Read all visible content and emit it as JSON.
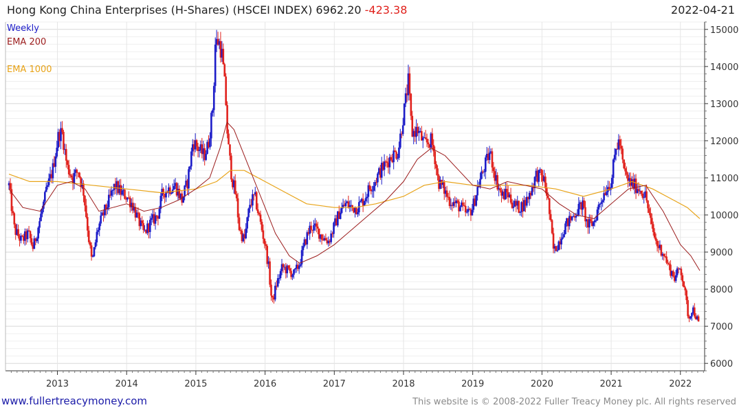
{
  "header": {
    "title": "Hong Kong China Enterprises (H-Shares) (HSCEI INDEX) 6962.20",
    "change": "-423.38",
    "date": "2022-04-21"
  },
  "footer": {
    "left": "www.fullertreacymoney.com",
    "right": "This website is © 2008-2022 Fuller Treacy Money plc. All rights reserved"
  },
  "colors": {
    "up": "#1c1cc8",
    "down": "#e0211c",
    "ema200": "#9b1b1b",
    "ema1000": "#e8a317",
    "grid": "#e2e2e2",
    "axis": "#333333"
  },
  "chart_data": {
    "type": "line",
    "subtype": "candlestick",
    "frequency_label": "Weekly",
    "ylim": [
      5800,
      15200
    ],
    "xlim": [
      2012.25,
      2022.35
    ],
    "yticks": [
      6000,
      7000,
      8000,
      9000,
      10000,
      11000,
      12000,
      13000,
      14000,
      15000
    ],
    "xticks": [
      {
        "label": "2013",
        "value": 2013
      },
      {
        "label": "2014",
        "value": 2014
      },
      {
        "label": "2015",
        "value": 2015
      },
      {
        "label": "2016",
        "value": 2016
      },
      {
        "label": "2017",
        "value": 2017
      },
      {
        "label": "2018",
        "value": 2018
      },
      {
        "label": "2019",
        "value": 2019
      },
      {
        "label": "2020",
        "value": 2020
      },
      {
        "label": "2021",
        "value": 2021
      },
      {
        "label": "2022",
        "value": 2022
      }
    ],
    "grid": true,
    "y_axis_position": "right",
    "legend_position": "top-left",
    "price_path": [
      [
        2012.3,
        10800
      ],
      [
        2012.38,
        9600
      ],
      [
        2012.48,
        9300
      ],
      [
        2012.58,
        9500
      ],
      [
        2012.65,
        9100
      ],
      [
        2012.75,
        9900
      ],
      [
        2012.85,
        10700
      ],
      [
        2012.93,
        11200
      ],
      [
        2013.02,
        12200
      ],
      [
        2013.07,
        12200
      ],
      [
        2013.14,
        11300
      ],
      [
        2013.22,
        11000
      ],
      [
        2013.3,
        11200
      ],
      [
        2013.38,
        10600
      ],
      [
        2013.45,
        9400
      ],
      [
        2013.5,
        8700
      ],
      [
        2013.58,
        9600
      ],
      [
        2013.66,
        10000
      ],
      [
        2013.75,
        10400
      ],
      [
        2013.83,
        10800
      ],
      [
        2013.92,
        10600
      ],
      [
        2014.0,
        10500
      ],
      [
        2014.08,
        10300
      ],
      [
        2014.16,
        9900
      ],
      [
        2014.25,
        9500
      ],
      [
        2014.35,
        9800
      ],
      [
        2014.45,
        10000
      ],
      [
        2014.52,
        10600
      ],
      [
        2014.6,
        10700
      ],
      [
        2014.7,
        10800
      ],
      [
        2014.8,
        10400
      ],
      [
        2014.88,
        10900
      ],
      [
        2014.96,
        12000
      ],
      [
        2015.03,
        11800
      ],
      [
        2015.12,
        11600
      ],
      [
        2015.18,
        11900
      ],
      [
        2015.25,
        13000
      ],
      [
        2015.28,
        14600
      ],
      [
        2015.33,
        14700
      ],
      [
        2015.38,
        14300
      ],
      [
        2015.43,
        13200
      ],
      [
        2015.46,
        12000
      ],
      [
        2015.52,
        11000
      ],
      [
        2015.58,
        10500
      ],
      [
        2015.63,
        9600
      ],
      [
        2015.7,
        9300
      ],
      [
        2015.78,
        10300
      ],
      [
        2015.85,
        10500
      ],
      [
        2015.92,
        9900
      ],
      [
        2016.0,
        9200
      ],
      [
        2016.05,
        8600
      ],
      [
        2016.1,
        7600
      ],
      [
        2016.16,
        8100
      ],
      [
        2016.25,
        8600
      ],
      [
        2016.33,
        8500
      ],
      [
        2016.42,
        8400
      ],
      [
        2016.5,
        8700
      ],
      [
        2016.58,
        9300
      ],
      [
        2016.66,
        9700
      ],
      [
        2016.75,
        9600
      ],
      [
        2016.83,
        9400
      ],
      [
        2016.92,
        9300
      ],
      [
        2017.0,
        9700
      ],
      [
        2017.08,
        10100
      ],
      [
        2017.17,
        10300
      ],
      [
        2017.25,
        10200
      ],
      [
        2017.33,
        10200
      ],
      [
        2017.42,
        10400
      ],
      [
        2017.5,
        10700
      ],
      [
        2017.58,
        10900
      ],
      [
        2017.67,
        11200
      ],
      [
        2017.75,
        11400
      ],
      [
        2017.83,
        11600
      ],
      [
        2017.92,
        11700
      ],
      [
        2018.0,
        12700
      ],
      [
        2018.07,
        13600
      ],
      [
        2018.12,
        12200
      ],
      [
        2018.2,
        12300
      ],
      [
        2018.3,
        11900
      ],
      [
        2018.4,
        12000
      ],
      [
        2018.45,
        11600
      ],
      [
        2018.5,
        10900
      ],
      [
        2018.58,
        10700
      ],
      [
        2018.66,
        10400
      ],
      [
        2018.75,
        10300
      ],
      [
        2018.83,
        10200
      ],
      [
        2018.92,
        10000
      ],
      [
        2019.0,
        10200
      ],
      [
        2019.08,
        10800
      ],
      [
        2019.17,
        11300
      ],
      [
        2019.25,
        11700
      ],
      [
        2019.33,
        11000
      ],
      [
        2019.42,
        10500
      ],
      [
        2019.5,
        10600
      ],
      [
        2019.58,
        10300
      ],
      [
        2019.66,
        10200
      ],
      [
        2019.75,
        10300
      ],
      [
        2019.83,
        10600
      ],
      [
        2019.92,
        11100
      ],
      [
        2020.02,
        11000
      ],
      [
        2020.08,
        10500
      ],
      [
        2020.17,
        9000
      ],
      [
        2020.25,
        9300
      ],
      [
        2020.33,
        9700
      ],
      [
        2020.42,
        9900
      ],
      [
        2020.5,
        10100
      ],
      [
        2020.58,
        10300
      ],
      [
        2020.66,
        9700
      ],
      [
        2020.75,
        9800
      ],
      [
        2020.83,
        10300
      ],
      [
        2020.92,
        10700
      ],
      [
        2021.0,
        10900
      ],
      [
        2021.07,
        11800
      ],
      [
        2021.12,
        12000
      ],
      [
        2021.18,
        11200
      ],
      [
        2021.25,
        10900
      ],
      [
        2021.33,
        10800
      ],
      [
        2021.42,
        10700
      ],
      [
        2021.5,
        10500
      ],
      [
        2021.58,
        9700
      ],
      [
        2021.66,
        9200
      ],
      [
        2021.75,
        9000
      ],
      [
        2021.83,
        8600
      ],
      [
        2021.92,
        8300
      ],
      [
        2022.0,
        8600
      ],
      [
        2022.05,
        8100
      ],
      [
        2022.12,
        7200
      ],
      [
        2022.17,
        7500
      ],
      [
        2022.22,
        7300
      ],
      [
        2022.28,
        6960
      ]
    ],
    "ema_200": [
      [
        2012.3,
        10700
      ],
      [
        2012.5,
        10200
      ],
      [
        2012.75,
        10100
      ],
      [
        2013.0,
        10800
      ],
      [
        2013.2,
        10900
      ],
      [
        2013.4,
        10700
      ],
      [
        2013.6,
        10100
      ],
      [
        2013.8,
        10200
      ],
      [
        2014.0,
        10300
      ],
      [
        2014.25,
        10100
      ],
      [
        2014.5,
        10200
      ],
      [
        2014.75,
        10400
      ],
      [
        2015.0,
        10700
      ],
      [
        2015.2,
        11000
      ],
      [
        2015.35,
        11800
      ],
      [
        2015.45,
        12500
      ],
      [
        2015.55,
        12300
      ],
      [
        2015.7,
        11600
      ],
      [
        2015.85,
        10900
      ],
      [
        2016.0,
        10200
      ],
      [
        2016.15,
        9500
      ],
      [
        2016.35,
        8900
      ],
      [
        2016.5,
        8700
      ],
      [
        2016.75,
        8900
      ],
      [
        2017.0,
        9200
      ],
      [
        2017.25,
        9600
      ],
      [
        2017.5,
        10000
      ],
      [
        2017.75,
        10400
      ],
      [
        2018.0,
        10900
      ],
      [
        2018.2,
        11500
      ],
      [
        2018.4,
        11800
      ],
      [
        2018.6,
        11600
      ],
      [
        2018.8,
        11200
      ],
      [
        2019.0,
        10800
      ],
      [
        2019.25,
        10700
      ],
      [
        2019.5,
        10900
      ],
      [
        2019.75,
        10800
      ],
      [
        2020.0,
        10700
      ],
      [
        2020.25,
        10300
      ],
      [
        2020.5,
        10000
      ],
      [
        2020.75,
        9900
      ],
      [
        2021.0,
        10300
      ],
      [
        2021.25,
        10700
      ],
      [
        2021.5,
        10800
      ],
      [
        2021.75,
        10100
      ],
      [
        2022.0,
        9200
      ],
      [
        2022.15,
        8900
      ],
      [
        2022.28,
        8500
      ]
    ],
    "ema_1000": [
      [
        2012.3,
        11100
      ],
      [
        2012.6,
        10900
      ],
      [
        2013.0,
        10900
      ],
      [
        2013.5,
        10800
      ],
      [
        2014.0,
        10700
      ],
      [
        2014.5,
        10600
      ],
      [
        2015.0,
        10700
      ],
      [
        2015.3,
        10900
      ],
      [
        2015.5,
        11200
      ],
      [
        2015.7,
        11200
      ],
      [
        2016.0,
        10900
      ],
      [
        2016.3,
        10600
      ],
      [
        2016.6,
        10300
      ],
      [
        2017.0,
        10200
      ],
      [
        2017.3,
        10200
      ],
      [
        2017.6,
        10300
      ],
      [
        2018.0,
        10500
      ],
      [
        2018.3,
        10800
      ],
      [
        2018.6,
        10900
      ],
      [
        2019.0,
        10800
      ],
      [
        2019.4,
        10800
      ],
      [
        2019.8,
        10800
      ],
      [
        2020.2,
        10700
      ],
      [
        2020.6,
        10500
      ],
      [
        2021.0,
        10700
      ],
      [
        2021.3,
        10900
      ],
      [
        2021.6,
        10700
      ],
      [
        2021.9,
        10400
      ],
      [
        2022.1,
        10200
      ],
      [
        2022.28,
        9900
      ]
    ]
  },
  "legend": {
    "weekly": "Weekly",
    "ema200": "EMA 200",
    "ema1000": "EMA 1000"
  }
}
